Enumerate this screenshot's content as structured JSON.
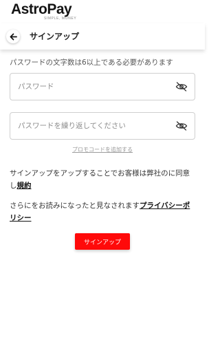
{
  "brand": {
    "name": "AstroPay",
    "tagline": "SIMPLE, MONEY"
  },
  "header": {
    "title": "サインアップ"
  },
  "form": {
    "hint": "パスワードの文字数は6以上である必要があります",
    "password_placeholder": "パスワード",
    "password_value": "",
    "confirm_placeholder": "パスワードを繰り返してください",
    "confirm_value": "",
    "promo_link": "プロモコードを追加する"
  },
  "legal": {
    "terms_text": "サインアップをアップすることでお客様は弊社のに同意し",
    "terms_link": "規約",
    "privacy_text": "さらにをお読みになったと見なされます",
    "privacy_link": "プライバシーポリシー"
  },
  "actions": {
    "signup_label": "サインアップ"
  },
  "colors": {
    "accent": "#ff0a0a"
  }
}
